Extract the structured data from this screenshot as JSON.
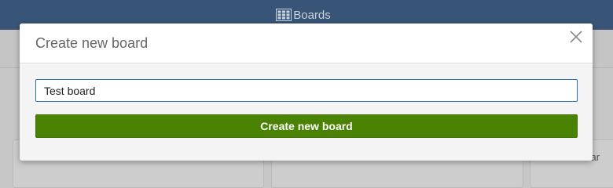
{
  "topbar": {
    "title": "Boards",
    "icon": "board-grid-icon",
    "background": "#385477"
  },
  "background_cards": [
    {
      "label": ""
    },
    {
      "label": ""
    },
    {
      "label": "nbar"
    }
  ],
  "modal": {
    "title": "Create new board",
    "close_icon": "close-icon",
    "input": {
      "value": "Test board",
      "placeholder": ""
    },
    "submit_label": "Create new board",
    "accent": "#4a8303"
  }
}
